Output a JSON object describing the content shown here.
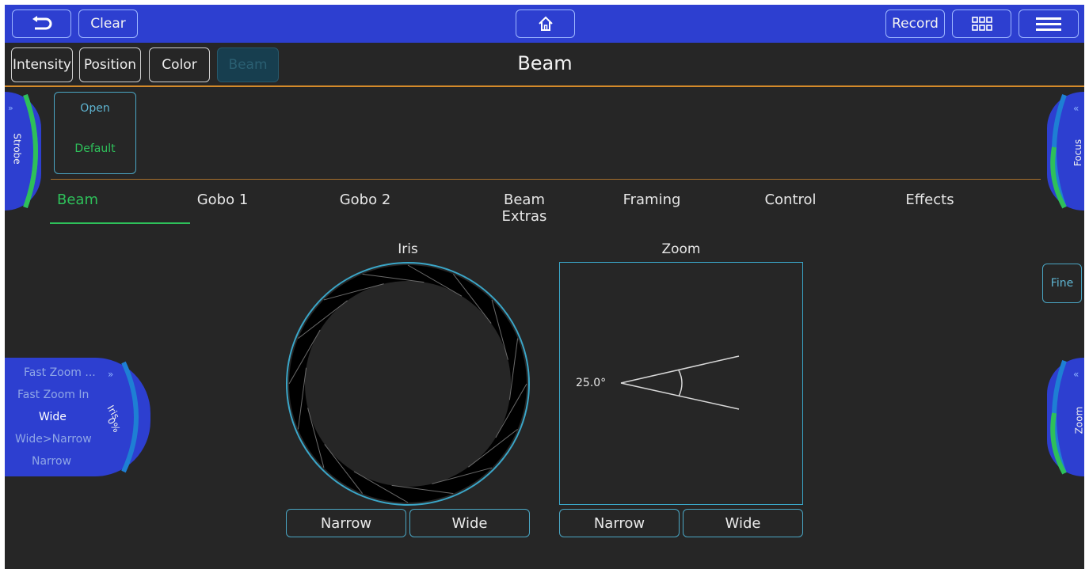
{
  "colors": {
    "accent_blue": "#2d3fd0",
    "green": "#2ec05a",
    "cyan": "#4aa6c4",
    "orange": "#d48a2a",
    "bg": "#262626"
  },
  "topbar": {
    "back_icon": "undo-arrow-icon",
    "clear_label": "Clear",
    "home_icon": "home-icon",
    "record_label": "Record",
    "grid_icon": "grid-icon",
    "menu_icon": "hamburger-menu-icon"
  },
  "attributes": {
    "intensity": "Intensity",
    "position": "Position",
    "color": "Color",
    "beam": "Beam"
  },
  "page_title": "Beam",
  "preset": {
    "line1": "Open",
    "line2": "Default"
  },
  "tabs": [
    "Beam",
    "Gobo 1",
    "Gobo 2",
    "Beam Extras",
    "Framing",
    "Control",
    "Effects"
  ],
  "left_wheels": {
    "strobe": "Strobe",
    "iris_label": "Iris",
    "iris_value": "0%",
    "iris_list": [
      "Fast Zoom ...",
      "Fast Zoom In",
      "Wide",
      "Wide>Narrow",
      "Narrow"
    ]
  },
  "right_wheels": {
    "focus": "Focus",
    "zoom": "Zoom",
    "fine": "Fine"
  },
  "iris": {
    "title": "Iris",
    "narrow": "Narrow",
    "wide": "Wide"
  },
  "zoom": {
    "title": "Zoom",
    "angle": "25.0°",
    "narrow": "Narrow",
    "wide": "Wide"
  }
}
